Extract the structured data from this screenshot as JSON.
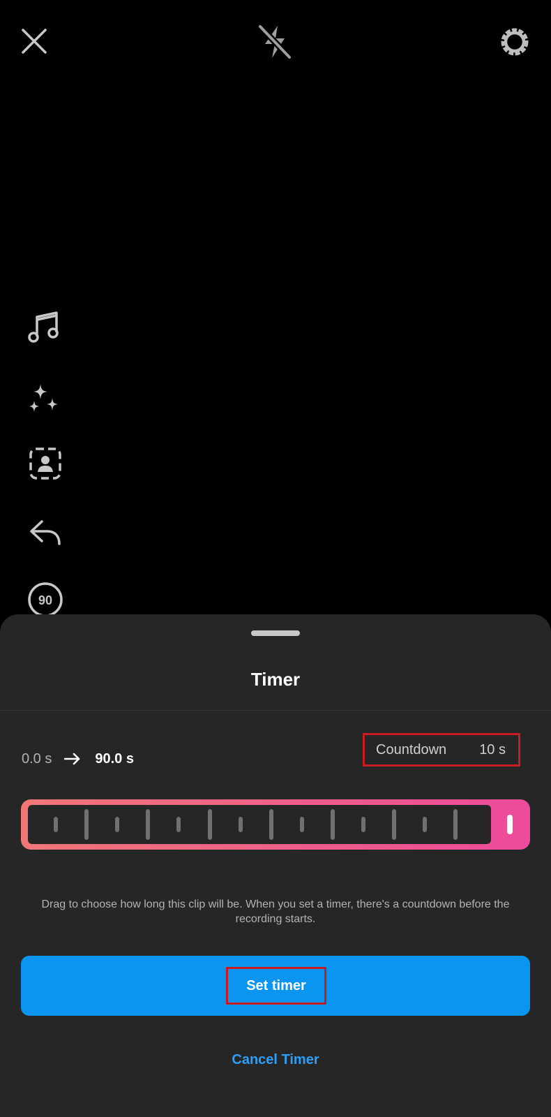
{
  "top_bar": {
    "close_icon": "close-icon",
    "flash_icon": "flash-off-icon",
    "settings_icon": "gear-icon"
  },
  "side_tools": {
    "items": [
      {
        "icon": "music-note-icon"
      },
      {
        "icon": "sparkles-icon"
      },
      {
        "icon": "portrait-icon"
      },
      {
        "icon": "reply-icon"
      },
      {
        "icon": "duration-icon",
        "label": "90"
      }
    ]
  },
  "sheet": {
    "title": "Timer",
    "range_start": "0.0 s",
    "range_end": "90.0 s",
    "countdown_label": "Countdown",
    "countdown_value": "10 s",
    "help_text": "Drag to choose how long this clip will be. When you set a timer, there's a countdown before the recording starts.",
    "set_button": "Set timer",
    "cancel_button": "Cancel Timer"
  },
  "colors": {
    "accent_blue": "#0a95f0",
    "link_blue": "#2e9ff5",
    "gradient_start": "#f37777",
    "gradient_end": "#ec4a9a",
    "highlight_red": "#c81c22"
  }
}
